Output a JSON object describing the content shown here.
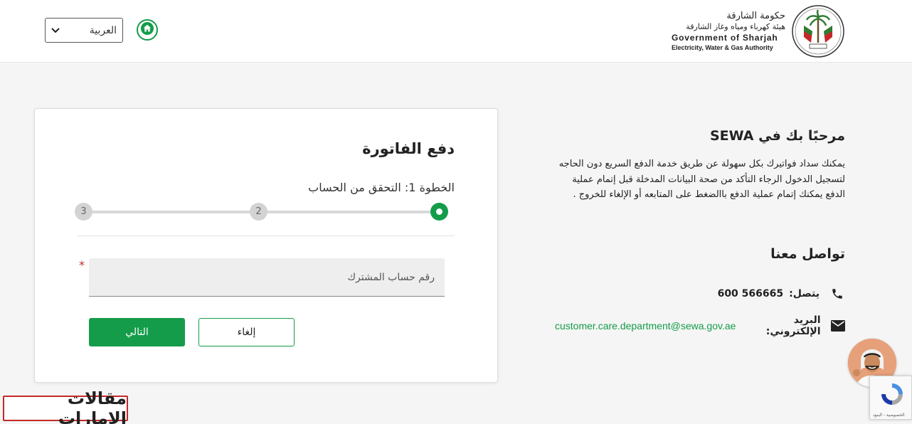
{
  "header": {
    "language_selected": "العربية",
    "logo": {
      "ar_line1": "حكومة الشارقة",
      "ar_line2": "هيئة كهرباء ومياه وغاز الشارقة",
      "en_line1": "Government of Sharjah",
      "en_line2": "Electricity, Water & Gas Authority"
    },
    "icons": {
      "home": "home-icon",
      "chevron": "chevron-down-icon"
    }
  },
  "card": {
    "title": "دفع الفاتورة",
    "step_label": "الخطوة 1: التحقق من الحساب",
    "steps": [
      "2",
      "3"
    ],
    "field_placeholder": "رقم حساب المشترك",
    "required_mark": "*",
    "cancel_label": "إلغاء",
    "next_label": "التالي"
  },
  "info": {
    "welcome_title": "مرحبًا بك في SEWA",
    "description": "يمكنك سداد فواتيرك بكل سهولة عن طريق خدمة الدفع السريع دون الحاجه لتسجيل الدخول الرجاء التأكد من صحة البيانات المدخلة قبل إتمام عملية الدفع يمكنك إتمام عملية الدفع باالضغط على المتابعه أو الإلغاء للخروج .",
    "contact_title": "تواصل معنا",
    "phone_label": "يتصل:",
    "phone_value": "600 566665",
    "email_label": "البريد الإلكتروني:",
    "email_value": "customer.care.department@sewa.gov.ae"
  },
  "recaptcha": {
    "text": "الخصوصية - البنود"
  },
  "watermark": {
    "text": "مقالات الإمارات"
  },
  "colors": {
    "accent": "#149c4a",
    "required": "#c62828",
    "step_inactive": "#d3d3d3"
  }
}
